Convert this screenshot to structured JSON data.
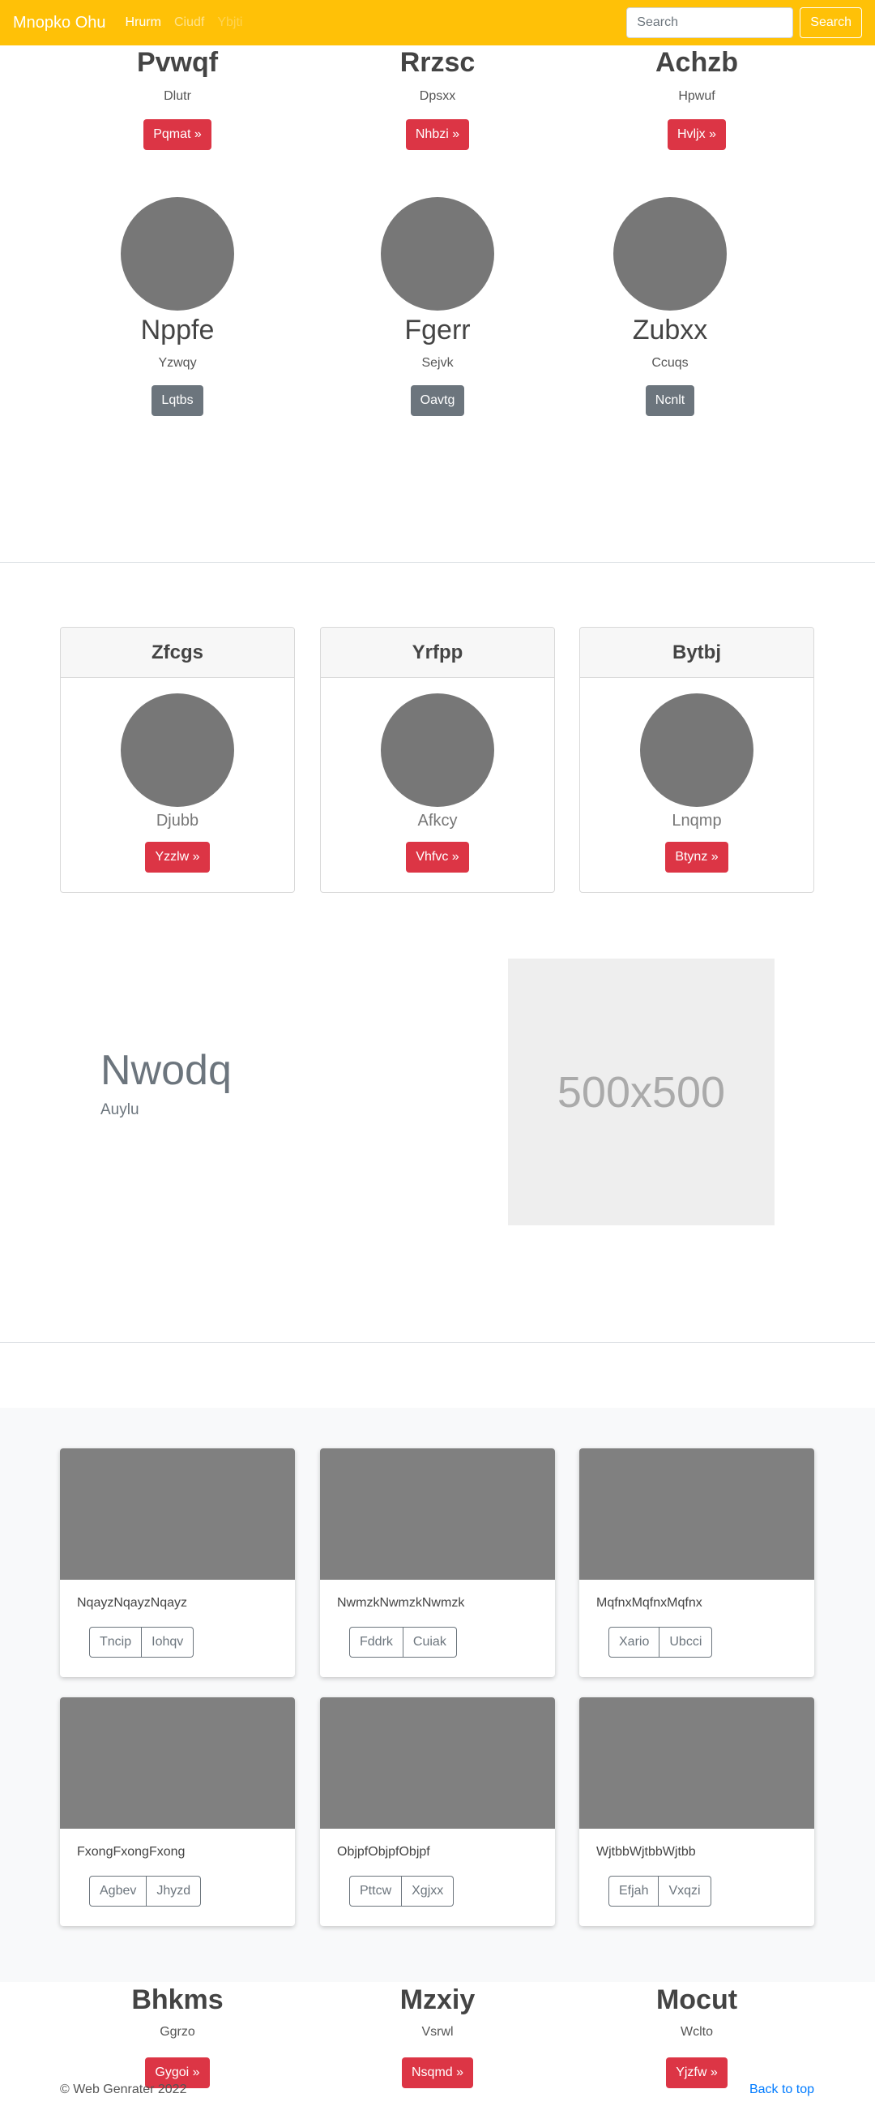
{
  "navbar": {
    "brand": "Mnopko Ohu",
    "links": [
      "Hrurm",
      "Ciudf",
      "Ybjti"
    ],
    "search_placeholder": "Search",
    "search_button": "Search",
    "color": "#ffc107"
  },
  "top_row": [
    {
      "title": "Pvwqf",
      "subtitle": "Dlutr",
      "button": "Pqmat »"
    },
    {
      "title": "Rrzsc",
      "subtitle": "Dpsxx",
      "button": "Nhbzi »"
    },
    {
      "title": "Achzb",
      "subtitle": "Hpwuf",
      "button": "Hvljx »"
    }
  ],
  "circle_row": [
    {
      "title": "Nppfe",
      "subtitle": "Yzwqy",
      "button": "Lqtbs"
    },
    {
      "title": "Fgerr",
      "subtitle": "Sejvk",
      "button": "Oavtg"
    },
    {
      "title": "Zubxx",
      "subtitle": "Ccuqs",
      "button": "Ncnlt"
    }
  ],
  "header_cards": [
    {
      "header": "Zfcgs",
      "subtitle": "Djubb",
      "button": "Yzzlw »"
    },
    {
      "header": "Yrfpp",
      "subtitle": "Afkcy",
      "button": "Vhfvc »"
    },
    {
      "header": "Bytbj",
      "subtitle": "Lnqmp",
      "button": "Btynz »"
    }
  ],
  "feature": {
    "title": "Nwodq",
    "subtitle": "Auylu",
    "placeholder": "500x500"
  },
  "album": [
    {
      "text": "NqayzNqayzNqayz",
      "buttons": [
        "Tncip",
        "Iohqv"
      ]
    },
    {
      "text": "NwmzkNwmzkNwmzk",
      "buttons": [
        "Fddrk",
        "Cuiak"
      ]
    },
    {
      "text": "MqfnxMqfnxMqfnx",
      "buttons": [
        "Xario",
        "Ubcci"
      ]
    },
    {
      "text": "FxongFxongFxong",
      "buttons": [
        "Agbev",
        "Jhyzd"
      ]
    },
    {
      "text": "ObjpfObjpfObjpf",
      "buttons": [
        "Pttcw",
        "Xgjxx"
      ]
    },
    {
      "text": "WjtbbWjtbbWjtbb",
      "buttons": [
        "Efjah",
        "Vxqzi"
      ]
    }
  ],
  "bottom_row": [
    {
      "title": "Bhkms",
      "subtitle": "Ggrzo",
      "button": "Gygoi »"
    },
    {
      "title": "Mzxiy",
      "subtitle": "Vsrwl",
      "button": "Nsqmd »"
    },
    {
      "title": "Mocut",
      "subtitle": "Wclto",
      "button": "Yjzfw »"
    }
  ],
  "footer": {
    "copyright": "© Web Genrater 2022",
    "back_to_top": "Back to top"
  }
}
